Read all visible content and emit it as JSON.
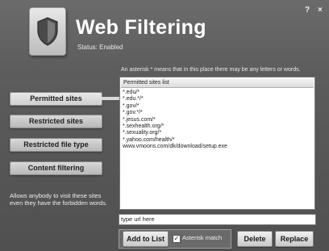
{
  "window": {
    "title": "Web Filtering",
    "status": "Status: Enabled",
    "help_label": "?",
    "close_label": "×"
  },
  "sidebar": {
    "items": [
      {
        "label": "Permitted sites"
      },
      {
        "label": "Restricted sites"
      },
      {
        "label": "Restricted file type"
      },
      {
        "label": "Content filtering"
      }
    ],
    "active_index": 0,
    "description": "Allows anybody to visit these sites even they have the forbidden words."
  },
  "main": {
    "asterisk_note": "An asterisk * means that in this place there may be any letters or words.",
    "list_header": "Permitted sites list",
    "list_items": [
      "*.edu/*",
      "*.edu.*/*",
      "*.gov/*",
      "*.gov.*/*",
      "*.jesus.com/*",
      "*.sexhealth.org/*",
      "*.sexuality.org/*",
      "*.yahoo.com/health/*",
      "www.vmoons.com/dk/download/setup.exe"
    ],
    "url_input_value": "type url here",
    "add_button": "Add to List",
    "asterisk_match_label": "Asterisk match",
    "asterisk_match_checked": true,
    "delete_button": "Delete",
    "replace_button": "Replace"
  },
  "icons": {
    "logo": "shield-icon",
    "check": "checkmark-icon"
  },
  "colors": {
    "background": "#5a5a5a",
    "title_text": "#ffffff"
  }
}
